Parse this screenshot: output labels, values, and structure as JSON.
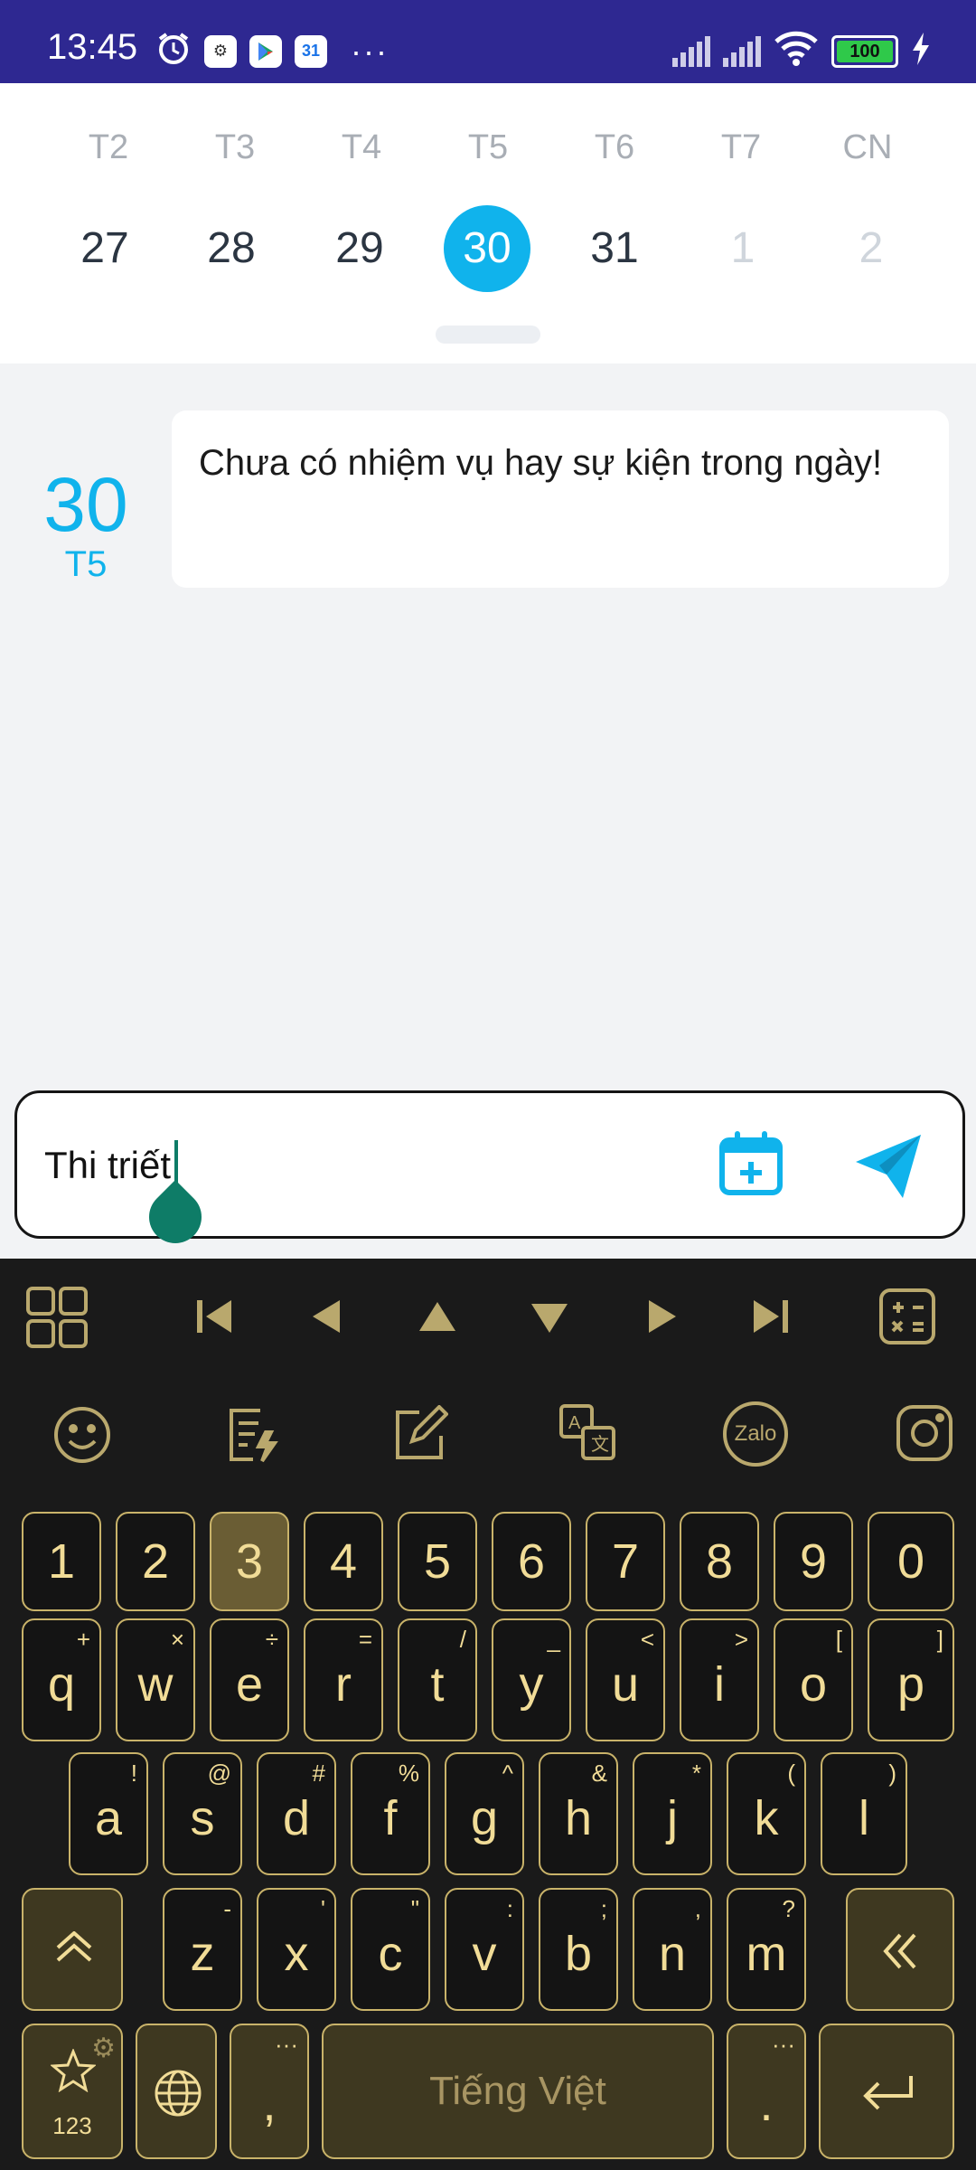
{
  "status_bar": {
    "time": "13:45",
    "more": "···",
    "battery": "100"
  },
  "week": {
    "day_names": [
      "T2",
      "T3",
      "T4",
      "T5",
      "T6",
      "T7",
      "CN"
    ],
    "dates": [
      "27",
      "28",
      "29",
      "30",
      "31",
      "1",
      "2"
    ],
    "selected_index": 3
  },
  "day": {
    "number": "30",
    "weekday": "T5",
    "empty_message": "Chưa có nhiệm vụ hay sự kiện trong ngày!"
  },
  "input": {
    "value": "Thi triết"
  },
  "keyboard": {
    "numbers": [
      "1",
      "2",
      "3",
      "4",
      "5",
      "6",
      "7",
      "8",
      "9",
      "0"
    ],
    "row1": [
      [
        "q",
        "+"
      ],
      [
        "w",
        "×"
      ],
      [
        "e",
        "÷"
      ],
      [
        "r",
        "="
      ],
      [
        "t",
        "/"
      ],
      [
        "y",
        "_"
      ],
      [
        "u",
        "<"
      ],
      [
        "i",
        ">"
      ],
      [
        "o",
        "["
      ],
      [
        "p",
        "]"
      ]
    ],
    "row2": [
      [
        "a",
        "!"
      ],
      [
        "s",
        "@"
      ],
      [
        "d",
        "#"
      ],
      [
        "f",
        "%"
      ],
      [
        "g",
        "^"
      ],
      [
        "h",
        "&"
      ],
      [
        "j",
        "*"
      ],
      [
        "k",
        "("
      ],
      [
        "l",
        ")"
      ]
    ],
    "row3": [
      [
        "z",
        "-"
      ],
      [
        "x",
        "'"
      ],
      [
        "c",
        "\""
      ],
      [
        "v",
        ":"
      ],
      [
        "b",
        ";"
      ],
      [
        "n",
        ","
      ],
      [
        "m",
        "?"
      ]
    ],
    "symbols_label": "123",
    "comma": ",",
    "period": ".",
    "ellipsis": "···",
    "space_label": "Tiếng Việt",
    "zalo_label": "Zalo"
  },
  "colors": {
    "status_bar": "#2e2891",
    "accent": "#10b3ec",
    "caret": "#0e7c67",
    "key_text": "#f1dc97",
    "key_border": "#c9b36a",
    "keyboard_bg": "#1a1a1a"
  }
}
